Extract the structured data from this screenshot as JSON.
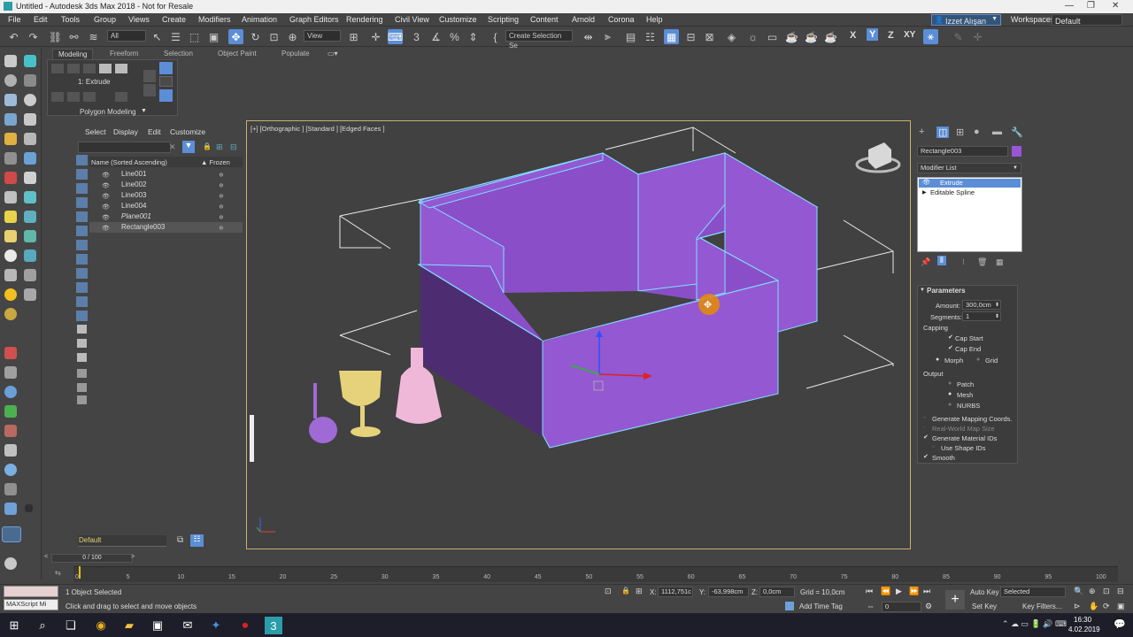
{
  "window": {
    "title": "Untitled - Autodesk 3ds Max 2018 - Not for Resale",
    "minimize": "—",
    "restore": "❐",
    "close": "✕"
  },
  "menu": [
    "File",
    "Edit",
    "Tools",
    "Group",
    "Views",
    "Create",
    "Modifiers",
    "Animation",
    "Graph Editors",
    "Rendering",
    "Civil View",
    "Customize",
    "Scripting",
    "Content",
    "Arnold",
    "Corona",
    "Help"
  ],
  "user": "Izzet Alışan",
  "workspaces": {
    "label": "Workspaces:",
    "value": "Default"
  },
  "toolbar": {
    "filter": "All",
    "view": "View",
    "selection_set": "Create Selection Se",
    "axes": [
      "X",
      "Y",
      "Z",
      "XY"
    ]
  },
  "ribbon": {
    "tabs": [
      "Modeling",
      "Freeform",
      "Selection",
      "Object Paint",
      "Populate"
    ],
    "modifier": "1: Extrude",
    "panel": "Polygon Modeling"
  },
  "scene_explorer": {
    "tabs": [
      "Select",
      "Display",
      "Edit",
      "Customize"
    ],
    "header": "Name (Sorted Ascending)",
    "frozen_header": "▲ Frozen",
    "items": [
      "Line001",
      "Line002",
      "Line003",
      "Line004",
      "Plane001",
      "Rectangle003"
    ],
    "layer": "Default"
  },
  "viewport": {
    "label": "[+] [Orthographic ] [Standard ] [Edged Faces ]"
  },
  "command_panel": {
    "object_name": "Rectangle003",
    "object_color": "#9a55d6",
    "modifier_list": "Modifier List",
    "stack": [
      "Extrude",
      "Editable Spline"
    ],
    "rollout": "Parameters",
    "amount_label": "Amount:",
    "amount": "300,0cm",
    "segments_label": "Segments:",
    "segments": "1",
    "capping": "Capping",
    "cap_start": "Cap Start",
    "cap_end": "Cap End",
    "morph": "Morph",
    "grid": "Grid",
    "output": "Output",
    "patch": "Patch",
    "mesh": "Mesh",
    "nurbs": "NURBS",
    "gen_mapping": "Generate Mapping Coords.",
    "real_world": "Real-World Map Size",
    "gen_material": "Generate Material IDs",
    "use_shape": "Use Shape IDs",
    "smooth": "Smooth"
  },
  "timeline": {
    "frame": "0 / 100",
    "ticks": [
      "0",
      "5",
      "10",
      "15",
      "20",
      "25",
      "30",
      "35",
      "40",
      "45",
      "50",
      "55",
      "60",
      "65",
      "70",
      "75",
      "80",
      "85",
      "90",
      "95",
      "100"
    ]
  },
  "status": {
    "selected": "1 Object Selected",
    "prompt": "Click and drag to select and move objects",
    "maxscript": "MAXScript Mi",
    "x_label": "X:",
    "x": "1112,751c",
    "y_label": "Y:",
    "y": "-63,998cm",
    "z_label": "Z:",
    "z": "0,0cm",
    "grid": "Grid = 10,0cm",
    "add_time_tag": "Add Time Tag",
    "auto_key": "Auto Key",
    "set_key": "Set Key",
    "key_mode": "Selected",
    "key_filters": "Key Filters...",
    "frame_field": "0"
  },
  "taskbar": {
    "time": "16:30",
    "date": "4.02.2019"
  },
  "colors": {
    "accent": "#5b8ed6",
    "wall": "#8a4fc8",
    "wall_dark": "#4e2c72",
    "highlight": "#7fe0ff",
    "viewport_border": "#c8b16b"
  }
}
